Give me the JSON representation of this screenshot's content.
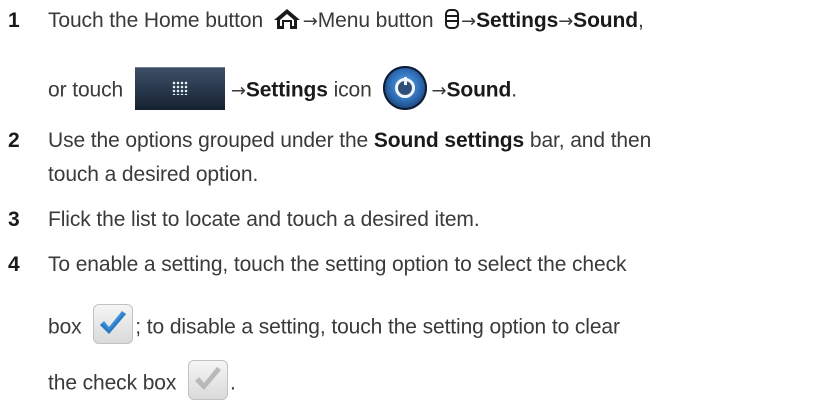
{
  "steps": [
    {
      "number": "1",
      "line1": {
        "t1": "Touch the Home button ",
        "arrow1": "→",
        "t2": "Menu button ",
        "arrow2": "→",
        "b1": "Settings",
        "arrow3": "→",
        "b2": "Sound",
        "t3": ","
      },
      "line2": {
        "t1": "or touch ",
        "arrow1": "→",
        "b1": "Settings",
        "t2": " icon ",
        "arrow2": "→",
        "b2": "Sound",
        "t3": "."
      }
    },
    {
      "number": "2",
      "line1": {
        "t1": "Use the options grouped under the ",
        "b1": "Sound settings",
        "t2": " bar, and then"
      },
      "line2": {
        "t1": "touch a desired option."
      }
    },
    {
      "number": "3",
      "line1": {
        "t1": "Flick the list to locate and touch a desired item."
      }
    },
    {
      "number": "4",
      "line1": {
        "t1": "To enable a setting, touch the setting option to select the check"
      },
      "line2": {
        "t1": "box ",
        "t2": "; to disable a setting, touch the setting option to clear"
      },
      "line3": {
        "t1": "the check box ",
        "t2": "."
      }
    }
  ],
  "icons": {
    "home": "home-icon",
    "menu": "menu-icon",
    "apps": "app-drawer-icon",
    "settings": "settings-icon",
    "check_selected": "checkbox-selected-icon",
    "check_cleared": "checkbox-cleared-icon"
  },
  "colors": {
    "text": "#3a3a3a",
    "bold": "#1a1a1a",
    "check_selected": "#3a8fd8",
    "check_cleared": "#b9b9b9"
  }
}
